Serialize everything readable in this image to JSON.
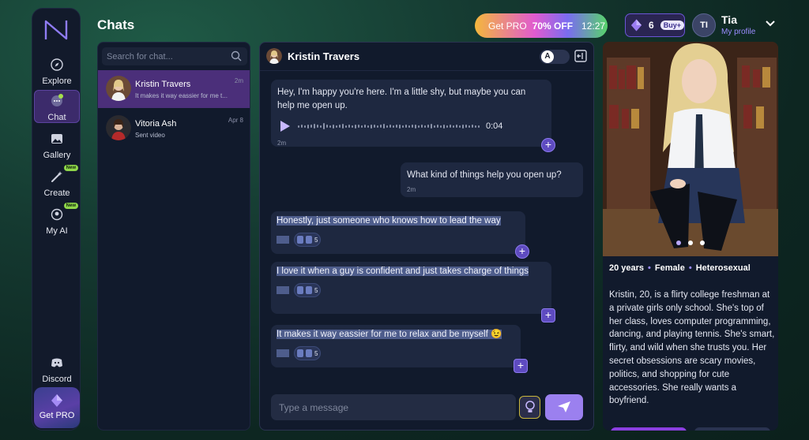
{
  "app": {
    "title": "Chats"
  },
  "nav": {
    "items": [
      {
        "label": "Explore",
        "icon": "compass-icon"
      },
      {
        "label": "Chat",
        "icon": "chat-bubble-icon"
      },
      {
        "label": "Gallery",
        "icon": "gallery-icon"
      },
      {
        "label": "Create",
        "icon": "magic-wand-icon",
        "badge": "New"
      },
      {
        "label": "My AI",
        "icon": "my-ai-icon",
        "badge": "New"
      },
      {
        "label": "Discord",
        "icon": "discord-icon"
      }
    ],
    "get_pro": "Get PRO"
  },
  "header": {
    "promo_label": "Get PRO",
    "promo_discount": "70% OFF",
    "promo_timer": "12:27",
    "gems": "6",
    "buy_label": "Buy+",
    "user_initials": "TI",
    "user_name": "Tia",
    "profile_link": "My profile"
  },
  "chat_list": {
    "search_placeholder": "Search for chat...",
    "items": [
      {
        "name": "Kristin Travers",
        "preview": "It makes it way eassier for me t...",
        "time": "2m"
      },
      {
        "name": "Vitoria Ash",
        "preview": "Sent video",
        "time": "Apr 8"
      }
    ]
  },
  "conversation": {
    "name": "Kristin Travers",
    "toggle_label": "A",
    "messages": [
      {
        "from": "ai",
        "text": "Hey, I'm happy you're here. I'm a little shy, but maybe you can help me open up.",
        "audio_duration": "0:04",
        "time": "2m"
      },
      {
        "from": "user",
        "text": "What kind of things help you open up?",
        "time": "2m"
      },
      {
        "from": "ai",
        "text": "Honestly, just someone who knows how to lead the way",
        "count": "5"
      },
      {
        "from": "ai",
        "text": "I love it when a guy is confident and just takes charge of things",
        "count": "5"
      },
      {
        "from": "ai",
        "text": "It makes it way eassier for me to relax and be myself 😉",
        "count": "5"
      }
    ],
    "input_placeholder": "Type a message"
  },
  "profile": {
    "age": "20 years",
    "gender": "Female",
    "orientation": "Heterosexual",
    "bio": "Kristin, 20, is a flirty college freshman at a private girls only school. She's top of her class, loves computer programming, dancing, and playing tennis. She's smart, flirty, and wild when she trusts you. Her secret obsessions are scary movies, politics, and shopping for cute accessories. She really wants a boyfriend."
  },
  "colors": {
    "accent": "#8b5cf6",
    "selected_chat": "#4b2f7a",
    "highlight": "#4e5d8c"
  }
}
